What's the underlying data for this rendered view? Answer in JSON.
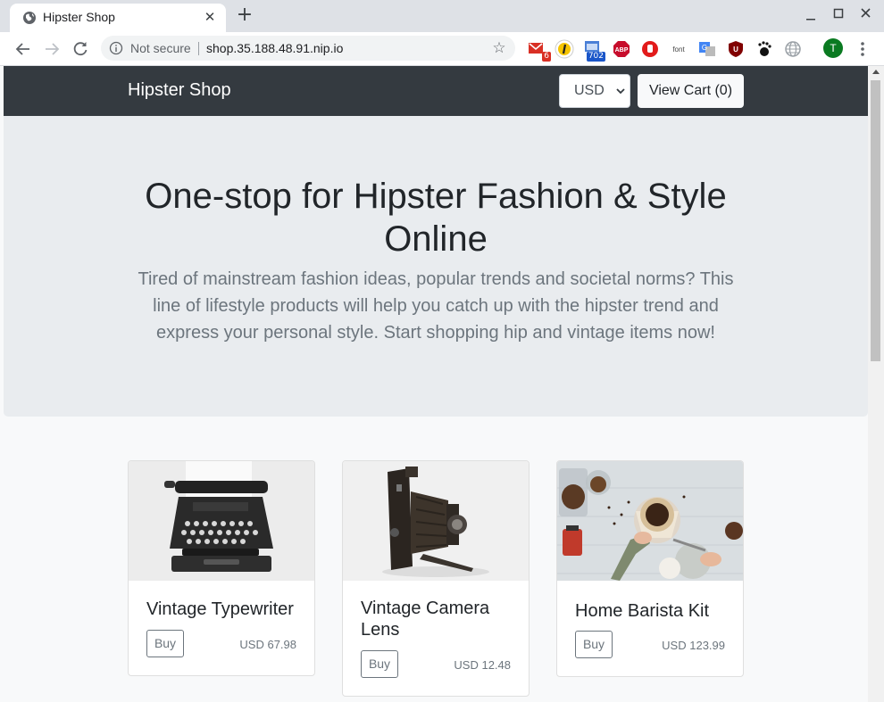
{
  "browser": {
    "tab_title": "Hipster Shop",
    "tab_close": "✕",
    "new_tab": "+",
    "security_label": "Not secure",
    "url": "shop.35.188.48.91.nip.io",
    "bookmark_star": "☆",
    "extensions": [
      {
        "name": "gmail-checker",
        "badge": "6"
      },
      {
        "name": "lastpass"
      },
      {
        "name": "calendar",
        "badge": "702"
      },
      {
        "name": "adblock-plus",
        "label": "ABP"
      },
      {
        "name": "stop-sign"
      },
      {
        "name": "font-finder",
        "label": "font"
      },
      {
        "name": "google-translate"
      },
      {
        "name": "ublock",
        "label": "U"
      },
      {
        "name": "gnome"
      },
      {
        "name": "globe"
      }
    ],
    "avatar_initial": "T"
  },
  "site": {
    "brand": "Hipster Shop",
    "currency": {
      "selected": "USD"
    },
    "cart_label": "View Cart (0)"
  },
  "hero": {
    "title": "One-stop for Hipster Fashion & Style Online",
    "lead": "Tired of mainstream fashion ideas, popular trends and societal norms? This line of lifestyle products will help you catch up with the hipster trend and express your personal style. Start shopping hip and vintage items now!"
  },
  "products": [
    {
      "name": "Vintage Typewriter",
      "buy": "Buy",
      "price": "USD 67.98"
    },
    {
      "name": "Vintage Camera Lens",
      "buy": "Buy",
      "price": "USD 12.48"
    },
    {
      "name": "Home Barista Kit",
      "buy": "Buy",
      "price": "USD 123.99"
    }
  ],
  "colors": {
    "navbar": "#343a40",
    "jumbotron": "#e9ecef",
    "page_bg": "#f8f9fa",
    "text_muted": "#6c757d"
  }
}
